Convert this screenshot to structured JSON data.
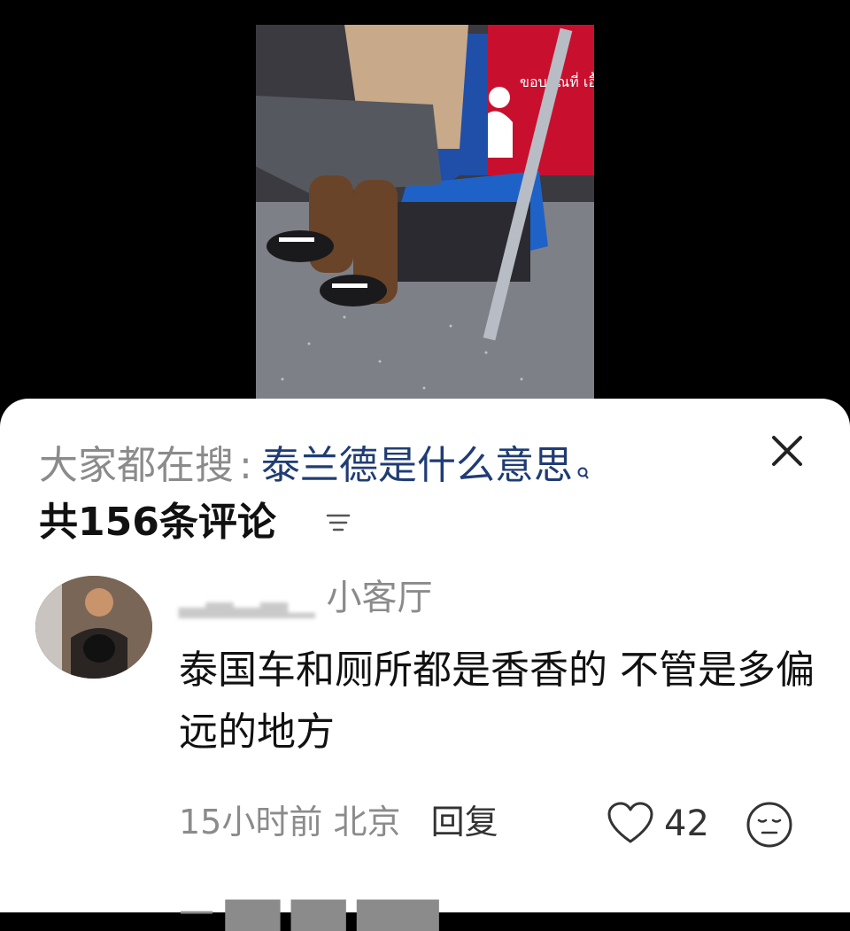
{
  "search": {
    "prefix": "大家都在搜",
    "separator": ":",
    "query": "泰兰德是什么意思",
    "icon": "search-icon"
  },
  "header": {
    "comment_count": "共156条评论",
    "sort_icon": "sort-icon",
    "close_icon": "close-icon"
  },
  "comment": {
    "user_visible": "小客厅",
    "text": "泰国车和厕所都是香香的 不管是多偏远的地方",
    "time": "15小时前",
    "location": "北京",
    "reply_label": "回复",
    "likes": "42",
    "like_icon": "heart-icon",
    "emoji_icon": "emoji-icon"
  },
  "video": {
    "sign_text": "ขอบคุณที่ เอื้อเฟื้อที่นั่ง"
  }
}
